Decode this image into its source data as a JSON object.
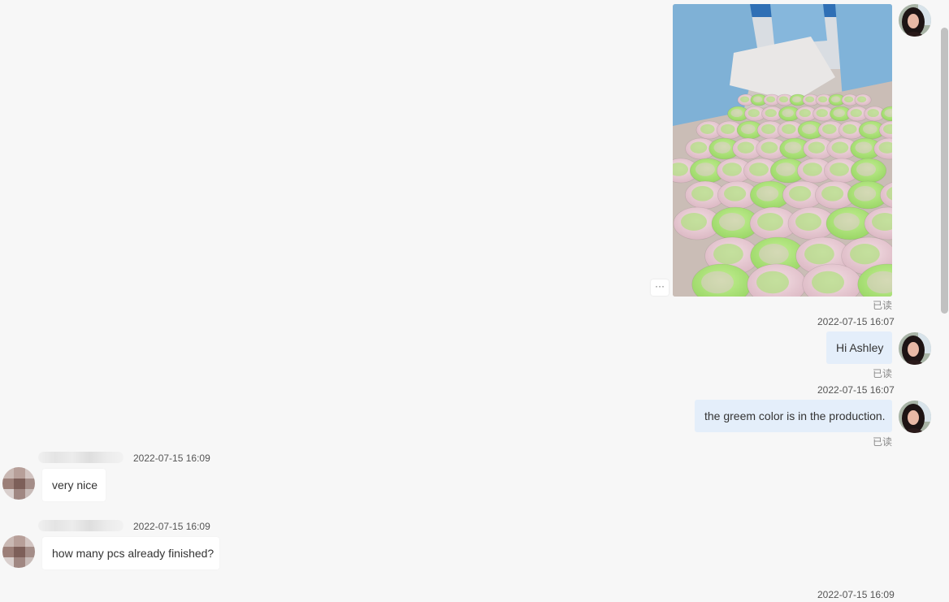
{
  "chat": {
    "messages": [
      {
        "type": "image",
        "direction": "out",
        "read_label": "已读",
        "more_label": "···",
        "image_alt": "Rows of pink and green egg-shaped bath bombs on a production table with workers in blue gowns"
      },
      {
        "type": "text",
        "direction": "out",
        "timestamp": "2022-07-15 16:07",
        "text": "Hi Ashley",
        "read_label": "已读"
      },
      {
        "type": "text",
        "direction": "out",
        "timestamp": "2022-07-15 16:07",
        "text": "the greem color is in the production.",
        "read_label": "已读"
      },
      {
        "type": "text",
        "direction": "in",
        "timestamp": "2022-07-15 16:09",
        "text": "very nice"
      },
      {
        "type": "text",
        "direction": "in",
        "timestamp": "2022-07-15 16:09",
        "text": "how many pcs already finished?"
      },
      {
        "type": "pending",
        "direction": "out",
        "timestamp": "2022-07-15 16:09"
      }
    ]
  },
  "colors": {
    "background": "#f7f7f7",
    "outgoing_bubble": "#e4eefa",
    "incoming_bubble": "#ffffff"
  }
}
